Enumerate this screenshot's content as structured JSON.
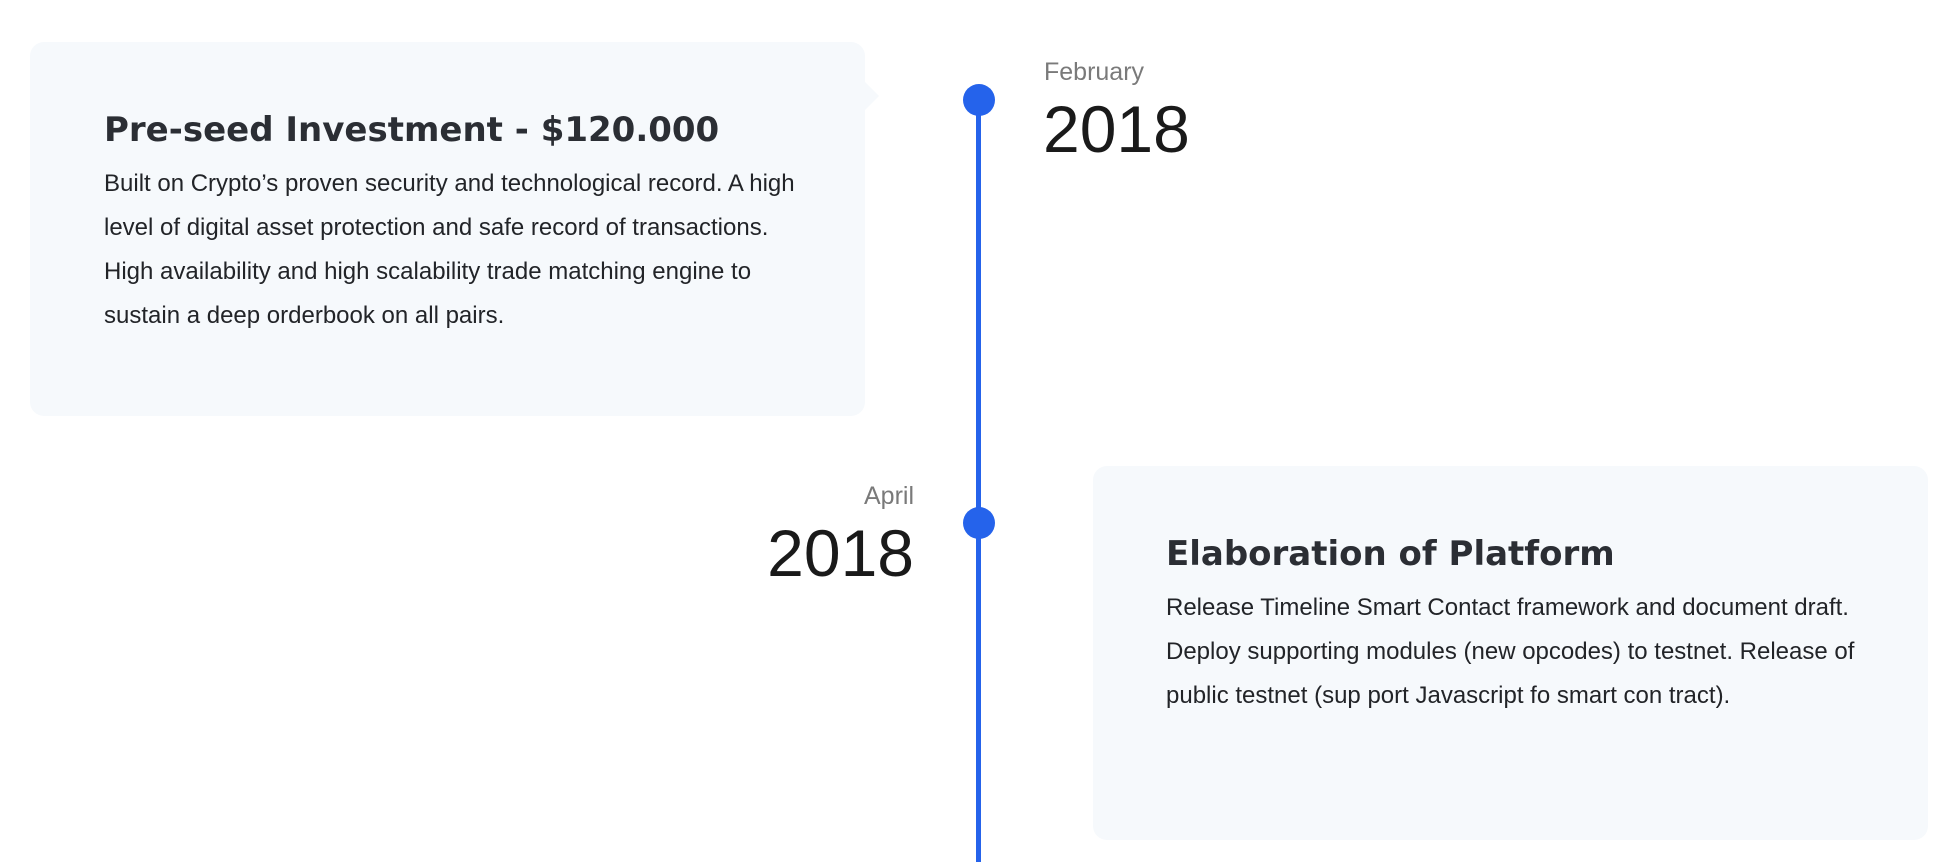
{
  "timeline": {
    "accent_color": "#2563eb",
    "card_background": "#f6f9fc",
    "milestones": [
      {
        "month": "February",
        "year": "2018",
        "title": "Pre-seed Investment - $120.000",
        "text": "Built on Crypto’s proven security and technological record. A high level of digital asset protection and safe record of transactions. High availability and high scalability trade matching engine to sustain a deep orderbook on all pairs."
      },
      {
        "month": "April",
        "year": "2018",
        "title": "Elaboration of Platform",
        "text": "Release Timeline Smart Contact framework and document draft. Deploy supporting modules (new opcodes) to testnet. Release of public testnet (sup port Javascript fo smart con tract)."
      }
    ]
  }
}
